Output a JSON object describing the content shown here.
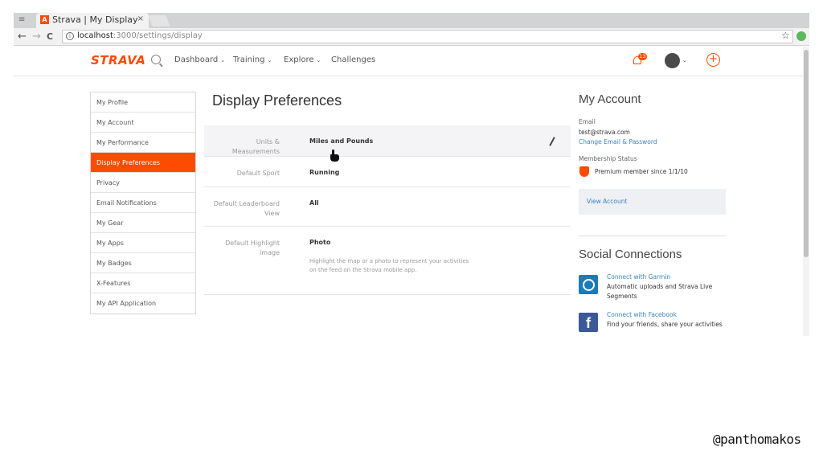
{
  "browser": {
    "tab_title": "Strava | My Display",
    "tab_close": "×",
    "url_host": "localhost",
    "url_path": ":3000/settings/display",
    "back": "←",
    "forward": "→",
    "reload": "C",
    "star": "☆"
  },
  "topnav": {
    "logo": "STRAVA",
    "items": [
      {
        "label": "Dashboard",
        "caret": "⌄"
      },
      {
        "label": "Training",
        "caret": "⌄"
      },
      {
        "label": "Explore",
        "caret": "⌄"
      },
      {
        "label": "Challenges",
        "caret": ""
      }
    ],
    "notification_count": "13",
    "plus": "+",
    "avatar_caret": "⌄"
  },
  "sidebar": {
    "items": [
      {
        "label": "My Profile"
      },
      {
        "label": "My Account"
      },
      {
        "label": "My Performance"
      },
      {
        "label": "Display Preferences",
        "active": true
      },
      {
        "label": "Privacy"
      },
      {
        "label": "Email Notifications"
      },
      {
        "label": "My Gear"
      },
      {
        "label": "My Apps"
      },
      {
        "label": "My Badges"
      },
      {
        "label": "X-Features"
      },
      {
        "label": "My API Application"
      }
    ]
  },
  "main": {
    "title": "Display Preferences",
    "rows": [
      {
        "label": "Units & Measurements",
        "value": "Miles and Pounds"
      },
      {
        "label": "Default Sport",
        "value": "Running"
      },
      {
        "label": "Default Leaderboard View",
        "value": "All"
      },
      {
        "label": "Default Highlight Image",
        "value": "Photo",
        "help": "Highlight the map or a photo to represent your activities on the feed on the Strava mobile app."
      }
    ]
  },
  "account": {
    "title": "My Account",
    "email_label": "Email",
    "email": "test@strava.com",
    "change_link": "Change Email & Password",
    "membership_label": "Membership Status",
    "membership": "Premium member since 1/1/10",
    "view_account": "View Account"
  },
  "social": {
    "title": "Social Connections",
    "garmin_link": "Connect with Garmin",
    "garmin_desc": "Automatic uploads and Strava Live Segments",
    "facebook_link": "Connect with Facebook",
    "facebook_desc": "Find your friends, share your activities",
    "facebook_glyph": "f"
  },
  "watermark": "@panthomakos",
  "colors": {
    "brand": "#fc4c02",
    "link": "#3b83c0"
  }
}
